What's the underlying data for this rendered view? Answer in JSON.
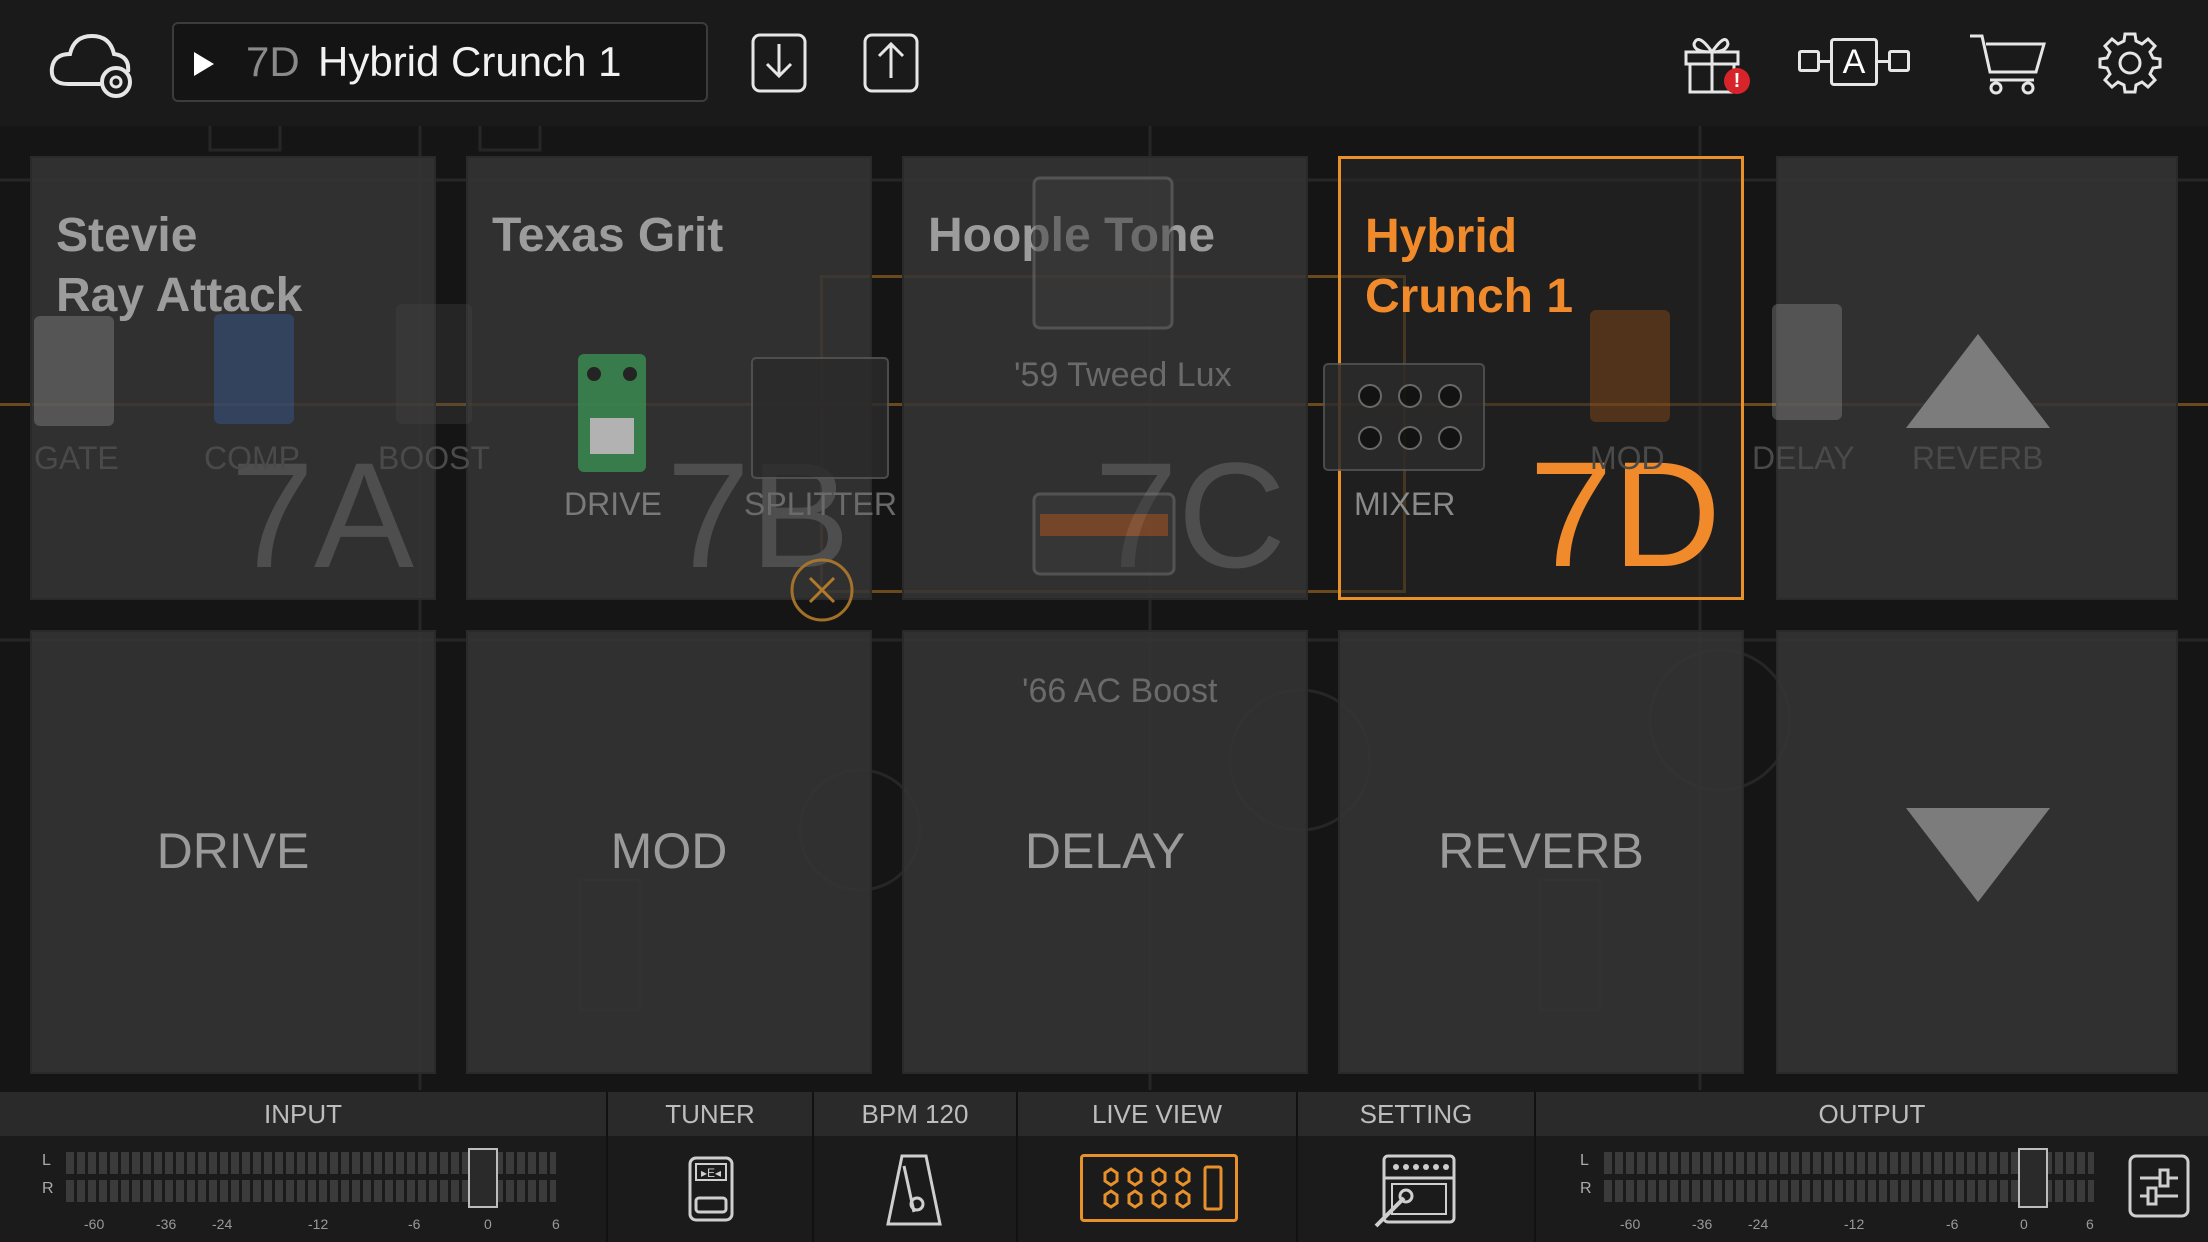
{
  "topbar": {
    "current_preset_id": "7D",
    "current_preset_name": "Hybrid Crunch 1",
    "icons": [
      "cloud-icon",
      "download-icon",
      "upload-icon",
      "gift-icon",
      "ab-compare-icon",
      "cart-icon",
      "gear-icon"
    ],
    "ab_label": "A",
    "gift_badge": "!"
  },
  "presets": [
    {
      "id": "7A",
      "name": "Stevie\nRay Attack",
      "selected": false
    },
    {
      "id": "7B",
      "name": "Texas Grit",
      "selected": false
    },
    {
      "id": "7C",
      "name": "Hoople Tone",
      "selected": false
    },
    {
      "id": "7D",
      "name": "Hybrid\nCrunch 1",
      "selected": true
    }
  ],
  "categories": [
    "DRIVE",
    "MOD",
    "DELAY",
    "REVERB"
  ],
  "chain": {
    "blocks": [
      "GATE",
      "COMP",
      "BOOST",
      "DRIVE",
      "SPLITTER",
      "MIXER",
      "MOD",
      "DELAY",
      "REVERB"
    ],
    "amps": [
      "'59 Tweed Lux",
      "'66 AC Boost"
    ]
  },
  "bottombar": {
    "input_label": "INPUT",
    "tuner_label": "TUNER",
    "bpm_label": "BPM 120",
    "liveview_label": "LIVE VIEW",
    "setting_label": "SETTING",
    "output_label": "OUTPUT",
    "meter_l": "L",
    "meter_r": "R",
    "meter_ticks": [
      "-60",
      "-36",
      "-24",
      "-12",
      "-6",
      "0",
      "6"
    ]
  },
  "colors": {
    "accent": "#f08a2a",
    "background": "#151515",
    "tile": "#343434"
  }
}
